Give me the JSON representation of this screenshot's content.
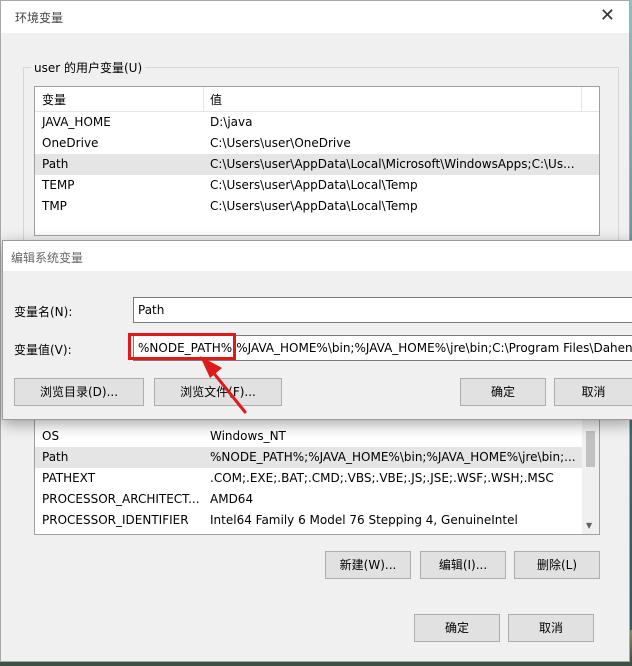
{
  "main_window": {
    "title": "环境变量",
    "close_glyph": "✕",
    "user_group_title": "user 的用户变量(U)",
    "list_headers": {
      "name": "变量",
      "value": "值"
    },
    "user_vars": [
      {
        "name": "JAVA_HOME",
        "value": "D:\\java"
      },
      {
        "name": "OneDrive",
        "value": "C:\\Users\\user\\OneDrive"
      },
      {
        "name": "Path",
        "value": "C:\\Users\\user\\AppData\\Local\\Microsoft\\WindowsApps;C:\\Us..."
      },
      {
        "name": "TEMP",
        "value": "C:\\Users\\user\\AppData\\Local\\Temp"
      },
      {
        "name": "TMP",
        "value": "C:\\Users\\user\\AppData\\Local\\Temp"
      }
    ],
    "user_selected_index": 2,
    "system_vars": [
      {
        "name": "OS",
        "value": "Windows_NT"
      },
      {
        "name": "Path",
        "value": "%NODE_PATH%;%JAVA_HOME%\\bin;%JAVA_HOME%\\jre\\bin;..."
      },
      {
        "name": "PATHEXT",
        "value": ".COM;.EXE;.BAT;.CMD;.VBS;.VBE;.JS;.JSE;.WSF;.WSH;.MSC"
      },
      {
        "name": "PROCESSOR_ARCHITECT...",
        "value": "AMD64"
      },
      {
        "name": "PROCESSOR_IDENTIFIER",
        "value": "Intel64 Family 6 Model 76 Stepping 4, GenuineIntel"
      }
    ],
    "system_selected_index": 1,
    "sys_buttons": {
      "new": "新建(W)...",
      "edit": "编辑(I)...",
      "delete": "删除(L)"
    },
    "footer_buttons": {
      "ok": "确定",
      "cancel": "取消"
    }
  },
  "edit_dialog": {
    "title": "编辑系统变量",
    "name_label": "变量名(N):",
    "name_value": "Path",
    "value_label": "变量值(V):",
    "value_value": "%NODE_PATH%;%JAVA_HOME%\\bin;%JAVA_HOME%\\jre\\bin;C:\\Program Files\\Dahen",
    "browse_dir": "浏览目录(D)...",
    "browse_file": "浏览文件(F)...",
    "ok": "确定",
    "cancel": "取消"
  },
  "colors": {
    "annotation_red": "#e0191b",
    "selected_row": "#e5e5e5",
    "window_bg": "#f0f0f0"
  },
  "icons": {
    "close": "close-icon",
    "scroll_up": "chevron-up-icon",
    "scroll_down": "chevron-down-icon"
  }
}
